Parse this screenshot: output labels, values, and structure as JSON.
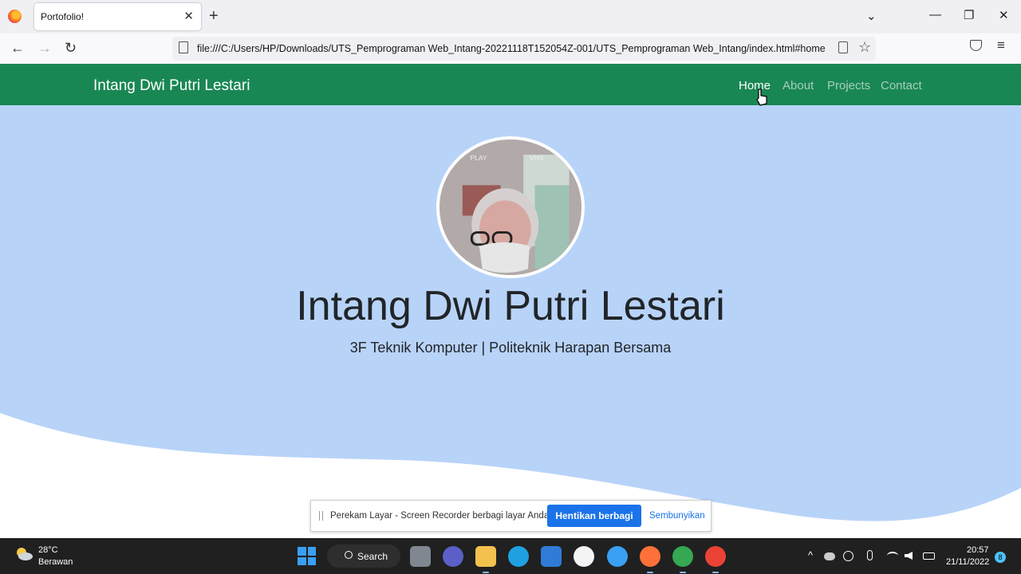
{
  "browser": {
    "tab_title": "Portofolio!",
    "tab_close": "✕",
    "new_tab": "+",
    "tab_list": "⌄",
    "minimize": "—",
    "restore": "❐",
    "close": "✕",
    "back": "←",
    "forward": "→",
    "reload": "↻",
    "url": "file:///C:/Users/HP/Downloads/UTS_Pemprograman Web_Intang-20221118T152054Z-001/UTS_Pemprograman Web_Intang/index.html#home",
    "star": "☆",
    "menu": "≡"
  },
  "site": {
    "brand": "Intang Dwi Putri Lestari",
    "nav": [
      {
        "label": "Home",
        "active": true
      },
      {
        "label": "About",
        "active": false
      },
      {
        "label": "Projects",
        "active": false
      },
      {
        "label": "Contact",
        "active": false
      }
    ],
    "hero": {
      "name": "Intang Dwi Putri Lestari",
      "subtitle": "3F Teknik Komputer | Politeknik Harapan Bersama",
      "photo_overlay_left": "PLAY",
      "photo_overlay_right": "VHS"
    },
    "colors": {
      "navbar": "#198754",
      "hero": "#b8d3f8"
    }
  },
  "screen_share": {
    "message": "Perekam Layar - Screen Recorder berbagi layar Anda.",
    "stop_label": "Hentikan berbagi",
    "hide_label": "Sembunyikan"
  },
  "taskbar": {
    "weather_temp": "28°C",
    "weather_desc": "Berawan",
    "search_label": "Search",
    "time": "20:57",
    "date": "21/11/2022",
    "notification_count": "8",
    "tray_chevron": "^"
  }
}
